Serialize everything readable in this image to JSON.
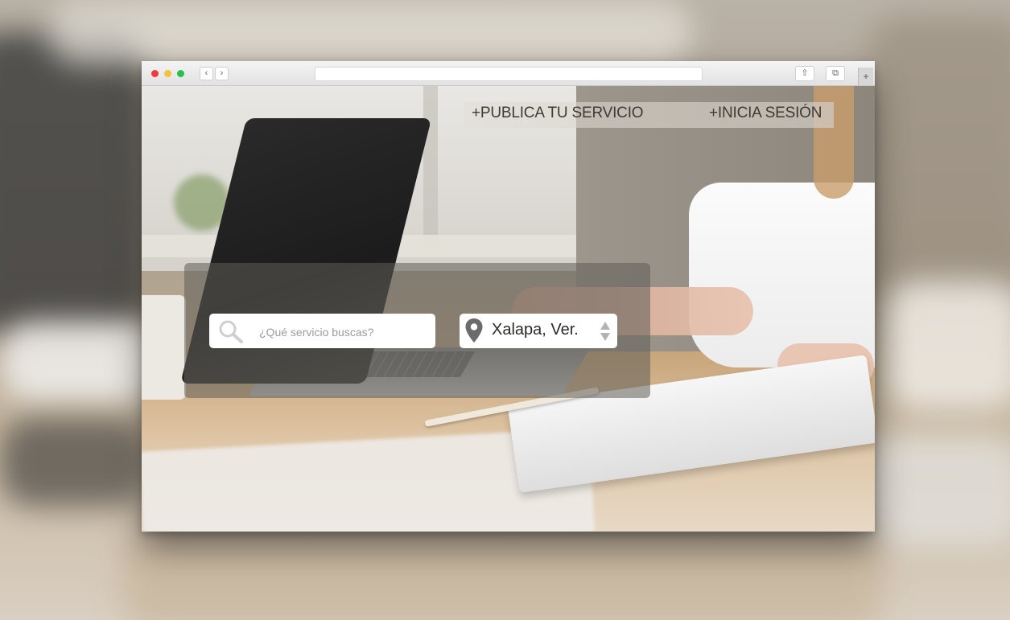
{
  "page_nav": {
    "publish_label": "+PUBLICA TU SERVICIO",
    "login_label": "+INICIA SESIÓN"
  },
  "search": {
    "placeholder": "¿Qué servicio buscas?",
    "value": ""
  },
  "location": {
    "selected": "Xalapa, Ver."
  },
  "browser": {
    "back_glyph": "‹",
    "forward_glyph": "›",
    "new_tab_glyph": "+",
    "share_glyph": "⇧",
    "tabs_glyph": "⧉"
  },
  "colors": {
    "close_dot": "#ee3b3b",
    "minimize_dot": "#f3c23a",
    "maximize_dot": "#27c04a",
    "nav_text": "#3e3b37"
  },
  "icons": [
    "search-icon",
    "map-pin-icon",
    "up-down-arrows-icon",
    "share-icon",
    "tabs-icon"
  ]
}
